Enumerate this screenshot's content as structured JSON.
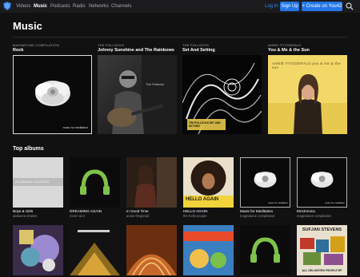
{
  "nav": {
    "items": [
      {
        "label": "Videos",
        "active": false
      },
      {
        "label": "Music",
        "active": true
      },
      {
        "label": "Podcasts",
        "active": false
      },
      {
        "label": "Radio",
        "active": false
      },
      {
        "label": "Networks",
        "active": false
      },
      {
        "label": "Channels",
        "active": false
      }
    ],
    "login_label": "Log In",
    "signup_label": "Sign Up",
    "create_label": "+ Create on You42"
  },
  "page": {
    "title": "Music"
  },
  "featured": [
    {
      "kicker": "MAGNATUNE COMPILATION",
      "title": "Rock",
      "art_caption": "music for meditation",
      "art": "white-rose-dark"
    },
    {
      "kicker": "THE POLLOCKS",
      "title": "Johnny Sunshine and The Rainbows",
      "art_caption": "The Pollocks",
      "art": "guitarist-photo"
    },
    {
      "kicker": "THE POLLOCKS",
      "title": "Set And Setting",
      "art_caption": "THE POLLOCKS SET AND SETTING",
      "art": "abstract-swirl"
    },
    {
      "kicker": "ANNIE FITZGERALD",
      "title": "You & Me & the Sun",
      "art_caption": "ANNIE FITZGERALD  you & me & the sun",
      "art": "yellow-portrait"
    }
  ],
  "top_albums": {
    "title": "Top albums",
    "items": [
      {
        "title": "Boys & Girls",
        "subtitle": "alabama shakes",
        "art": "gray-text-cover",
        "art_caption": "ALABAMA SHAKES"
      },
      {
        "title": "DREAMING AGAIN",
        "subtitle": "mmm as it",
        "art": "headphones-placeholder"
      },
      {
        "title": "In Good Time",
        "subtitle": "annie fitzgerald",
        "art": "portrait-dark"
      },
      {
        "title": "HELLO AGAIN",
        "subtitle": "the hello people",
        "art": "afro-hello",
        "art_caption": "HELLO AGAIN"
      },
      {
        "title": "Music for Meditation",
        "subtitle": "magnatune compilation",
        "art": "white-rose-dark",
        "art_caption": "music for meditation"
      },
      {
        "title": "Electronica",
        "subtitle": "magnatune compilation",
        "art": "white-rose-dark",
        "art_caption": "music for meditation"
      }
    ],
    "row2": [
      {
        "art": "collage-purple"
      },
      {
        "art": "dark-gold"
      },
      {
        "art": "orange-jazz"
      },
      {
        "art": "comic-cover"
      },
      {
        "art": "headphones-placeholder"
      },
      {
        "art": "sufjan-collage",
        "art_caption": "SUFJAN STEVENS",
        "art_caption2": "ALL DELIGHTED PEOPLE EP"
      }
    ]
  },
  "colors": {
    "accent": "#2376e5",
    "link": "#3d8cff",
    "background": "#111112",
    "placeholder_green": "#7ec24a"
  }
}
